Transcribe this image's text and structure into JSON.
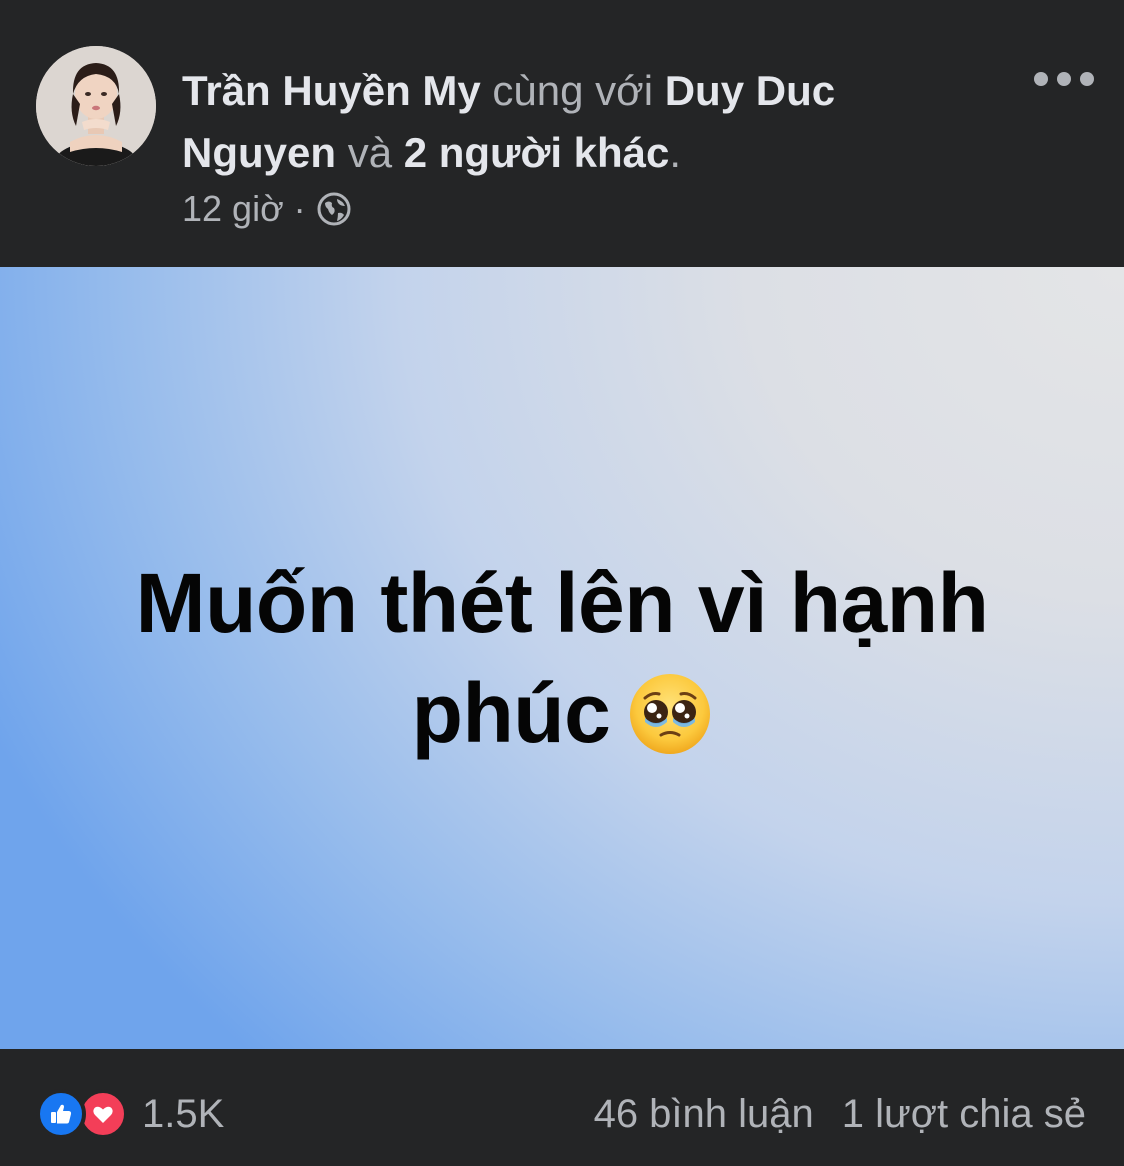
{
  "post": {
    "author": "Trần Huyền My",
    "with_label": "cùng với",
    "tagged_first": "Duy Duc Nguyen",
    "and_label": "và",
    "tagged_others": "2 người khác",
    "period": ".",
    "timestamp": "12 giờ",
    "separator": "·",
    "privacy_icon": "globe-icon"
  },
  "status": {
    "text": "Muốn thét lên vì hạnh phúc",
    "emoji": "pleading-face-emoji",
    "background_colors": [
      "#e4e5e7",
      "#dcdfe5",
      "#c3d3ec",
      "#97bcec",
      "#6fa4ec"
    ]
  },
  "footer": {
    "reaction_icons": [
      "like-icon",
      "love-icon"
    ],
    "reaction_count": "1.5K",
    "comments": "46 bình luận",
    "shares": "1 lượt chia sẻ"
  },
  "colors": {
    "background": "#242526",
    "primary_text": "#e4e6eb",
    "secondary_text": "#b0b3b8",
    "like_blue": "#1877f2",
    "love_red": "#f33e58"
  }
}
